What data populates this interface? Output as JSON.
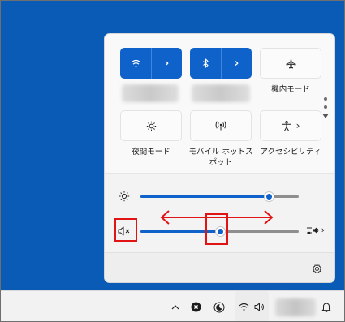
{
  "panel": {
    "tiles": [
      {
        "id": "wifi",
        "state": "on",
        "icon": "wifi-icon",
        "chevron": "›"
      },
      {
        "id": "bluetooth",
        "state": "on",
        "icon": "bluetooth-icon",
        "chevron": "›"
      },
      {
        "id": "airplane",
        "state": "off",
        "icon": "airplane-icon",
        "label": "機内モード"
      },
      {
        "id": "night-light",
        "state": "off",
        "icon": "night-light-icon",
        "label": "夜間モード"
      },
      {
        "id": "hotspot",
        "state": "off",
        "icon": "hotspot-icon",
        "label": "モバイル ホットスポット"
      },
      {
        "id": "accessibility",
        "state": "off",
        "icon": "accessibility-icon",
        "label": "アクセシビリティ",
        "chevron": "›"
      }
    ],
    "brightness": {
      "icon": "sun-icon",
      "level": 0.81
    },
    "volume": {
      "icon": "speaker-muted-icon",
      "level": 0.5,
      "output_icon": "audio-output-icon",
      "chevron": "›"
    },
    "settings_icon": "gear-icon"
  },
  "taskbar": {
    "icons": [
      "chevron-up-icon",
      "close-circle-icon",
      "focus-moon-icon",
      "wifi-icon",
      "speaker-icon",
      "bell-icon"
    ]
  },
  "colors": {
    "accent": "#0f62c9",
    "desktop": "#0a5bb5",
    "annotation": "#e01414"
  }
}
